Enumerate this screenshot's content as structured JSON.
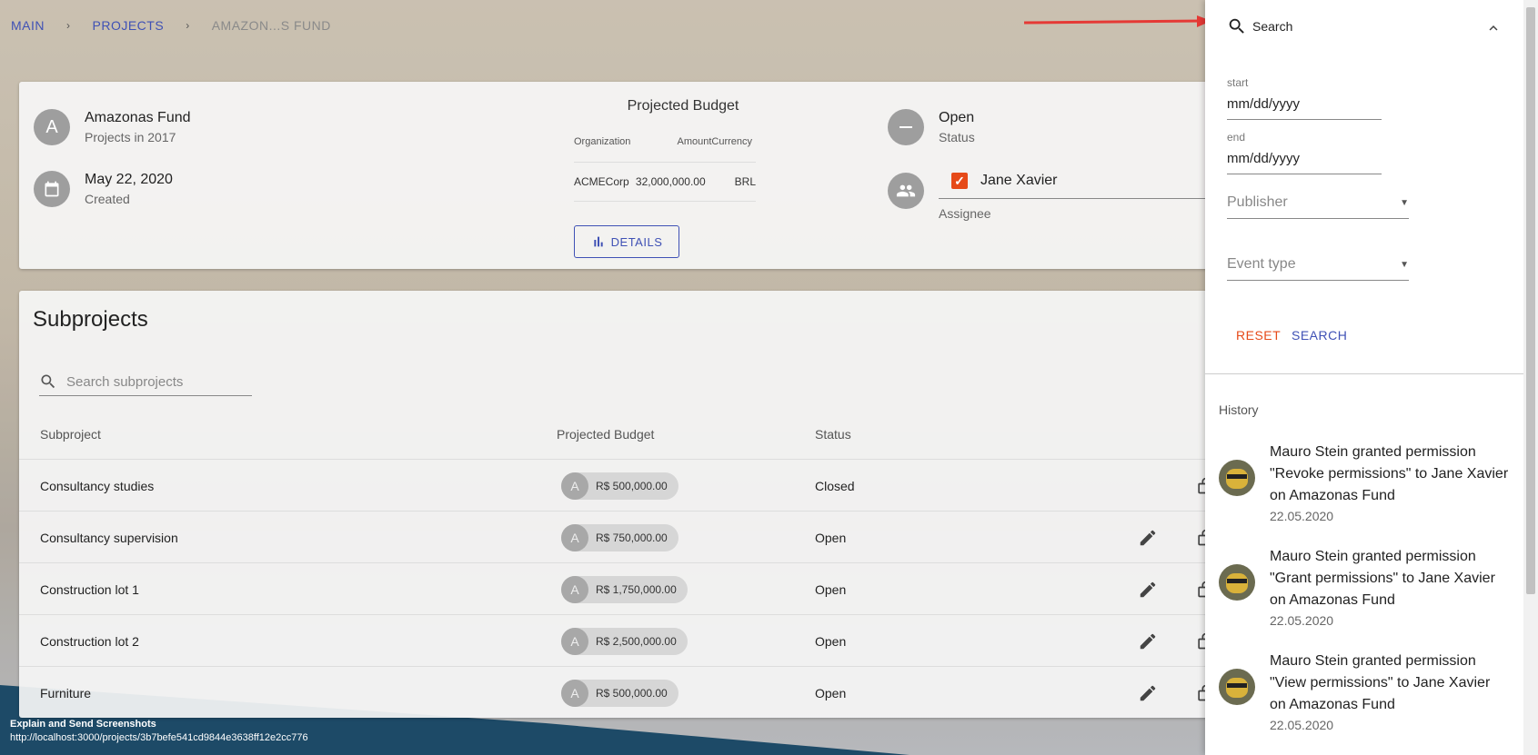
{
  "breadcrumb": {
    "main": "MAIN",
    "projects": "PROJECTS",
    "current": "AMAZON...S FUND",
    "sep": "›"
  },
  "project": {
    "avatar_letter": "A",
    "name": "Amazonas Fund",
    "subtitle": "Projects in 2017",
    "created_date": "May 22, 2020",
    "created_label": "Created",
    "budget_title": "Projected Budget",
    "budget_headers": [
      "Organization",
      "Amount",
      "Currency"
    ],
    "budget_rows": [
      [
        "ACMECorp",
        "32,000,000.00",
        "BRL"
      ]
    ],
    "details_label": "DETAILS",
    "status_value": "Open",
    "status_label": "Status",
    "assignee_name": "Jane Xavier",
    "assignee_label": "Assignee"
  },
  "subprojects": {
    "title": "Subprojects",
    "search_placeholder": "Search subprojects",
    "headers": {
      "subproject": "Subproject",
      "budget": "Projected Budget",
      "status": "Status"
    },
    "rows": [
      {
        "name": "Consultancy studies",
        "chip_letter": "A",
        "budget": "R$ 500,000.00",
        "status": "Closed"
      },
      {
        "name": "Consultancy supervision",
        "chip_letter": "A",
        "budget": "R$ 750,000.00",
        "status": "Open"
      },
      {
        "name": "Construction lot 1",
        "chip_letter": "A",
        "budget": "R$ 1,750,000.00",
        "status": "Open"
      },
      {
        "name": "Construction lot 2",
        "chip_letter": "A",
        "budget": "R$ 2,500,000.00",
        "status": "Open"
      },
      {
        "name": "Furniture",
        "chip_letter": "A",
        "budget": "R$ 500,000.00",
        "status": "Open"
      }
    ]
  },
  "drawer": {
    "search_title": "Search",
    "start_label": "start",
    "start_value": "mm/dd/yyyy",
    "end_label": "end",
    "end_value": "mm/dd/yyyy",
    "publisher_placeholder": "Publisher",
    "event_type_placeholder": "Event type",
    "reset_label": "RESET",
    "search_label": "SEARCH",
    "history_title": "History",
    "history": [
      {
        "text": "Mauro Stein granted permission \"Revoke permissions\" to Jane Xavier on Amazonas Fund",
        "date": "22.05.2020"
      },
      {
        "text": "Mauro Stein granted permission \"Grant permissions\" to Jane Xavier on Amazonas Fund",
        "date": "22.05.2020"
      },
      {
        "text": "Mauro Stein granted permission \"View permissions\" to Jane Xavier on Amazonas Fund",
        "date": "22.05.2020"
      }
    ]
  },
  "footer": {
    "line1": "Explain and Send Screenshots",
    "line2": "http://localhost:3000/projects/3b7befe541cd9844e3638ff12e2cc776"
  },
  "colors": {
    "primary": "#3f51b5",
    "accent": "#e64a19",
    "arrow": "#e53935"
  }
}
